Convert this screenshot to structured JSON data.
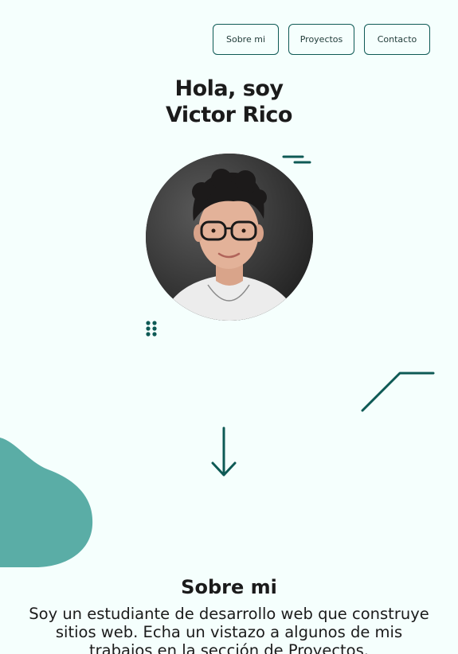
{
  "nav": {
    "items": [
      {
        "label": "Sobre mi"
      },
      {
        "label": "Proyectos"
      },
      {
        "label": "Contacto"
      }
    ]
  },
  "hero": {
    "line1": "Hola, soy",
    "line2": "Victor Rico",
    "avatar_icon": "profile-photo"
  },
  "about": {
    "title": "Sobre mi",
    "text": "Soy un estudiante de desarrollo web que construye sitios web. Echa un vistazo a algunos de mis trabajos en la sección de Proyectos."
  },
  "colors": {
    "background": "#f5fffd",
    "accent": "#0e5a55",
    "blob": "#5aada6"
  }
}
